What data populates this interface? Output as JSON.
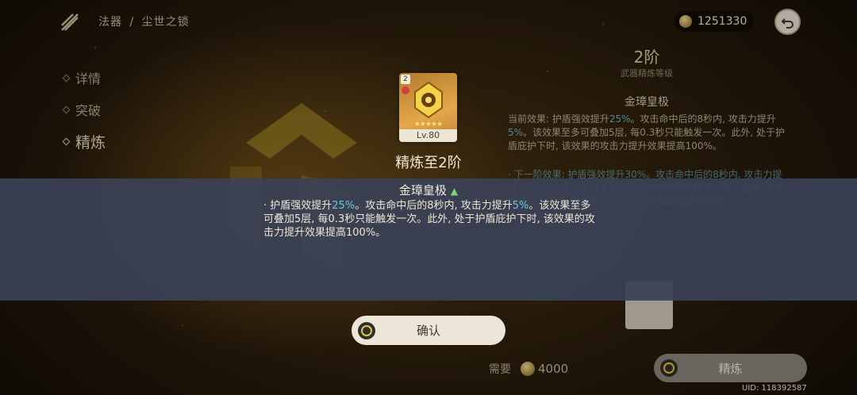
{
  "breadcrumb": {
    "category": "法器",
    "separator": "/",
    "item": "尘世之锁"
  },
  "currency": {
    "amount": "1251330"
  },
  "nav": {
    "items": [
      "详情",
      "突破",
      "精炼"
    ],
    "active": "精炼"
  },
  "right_panel": {
    "level": "2阶",
    "subtitle": "武器精炼等级",
    "weapon_effect_name": "金璋皇极",
    "current_label": "当前效果: ",
    "current_text_a": "护盾强效提升",
    "current_value_a": "25%",
    "current_text_b": "。攻击命中后的8秒内, 攻击力提升",
    "current_value_b": "5%",
    "current_text_c": "。该效果至多可叠加5层, 每0.3秒只能触发一次。此外, 处于护盾庇护下时, 该效果的攻击力提升效果提高100%。",
    "next_text": "· 下一阶效果: 护盾强效提升30%。攻击命中后的8秒内, 攻击力提升6%。该效果至多可叠加5层, 每0.3秒只能触发一次。此外, 处于护盾庇护下时, 该效果的攻击力提升效果提高100%。",
    "need_label": "需要",
    "need_amount": "4000",
    "refine_button": "精炼"
  },
  "popup": {
    "card_rank": "2",
    "card_level": "Lv.80",
    "card_stars": "★★★★★",
    "title": "精炼至2阶",
    "effect_name": "金璋皇极",
    "effect_bullet": "· ",
    "effect_text_a": "护盾强效提升",
    "effect_value_a": "25%",
    "effect_text_b": "。攻击命中后的8秒内, 攻击力提升",
    "effect_value_b": "5%",
    "effect_text_c": "。该效果至多可叠加5层, 每0.3秒只能触发一次。此外, 处于护盾庇护下时, 该效果的攻击力提升效果提高100%。",
    "confirm_button": "确认"
  },
  "uid": "UID: 118392587",
  "colors": {
    "highlight": "#69c7e0",
    "up_arrow": "#7bd37b",
    "button_bg": "#ece5d8"
  },
  "icons": [
    "weapon-category-icon",
    "coin-icon",
    "back-icon",
    "up-arrow-icon",
    "lock-icon",
    "ring-icon"
  ]
}
